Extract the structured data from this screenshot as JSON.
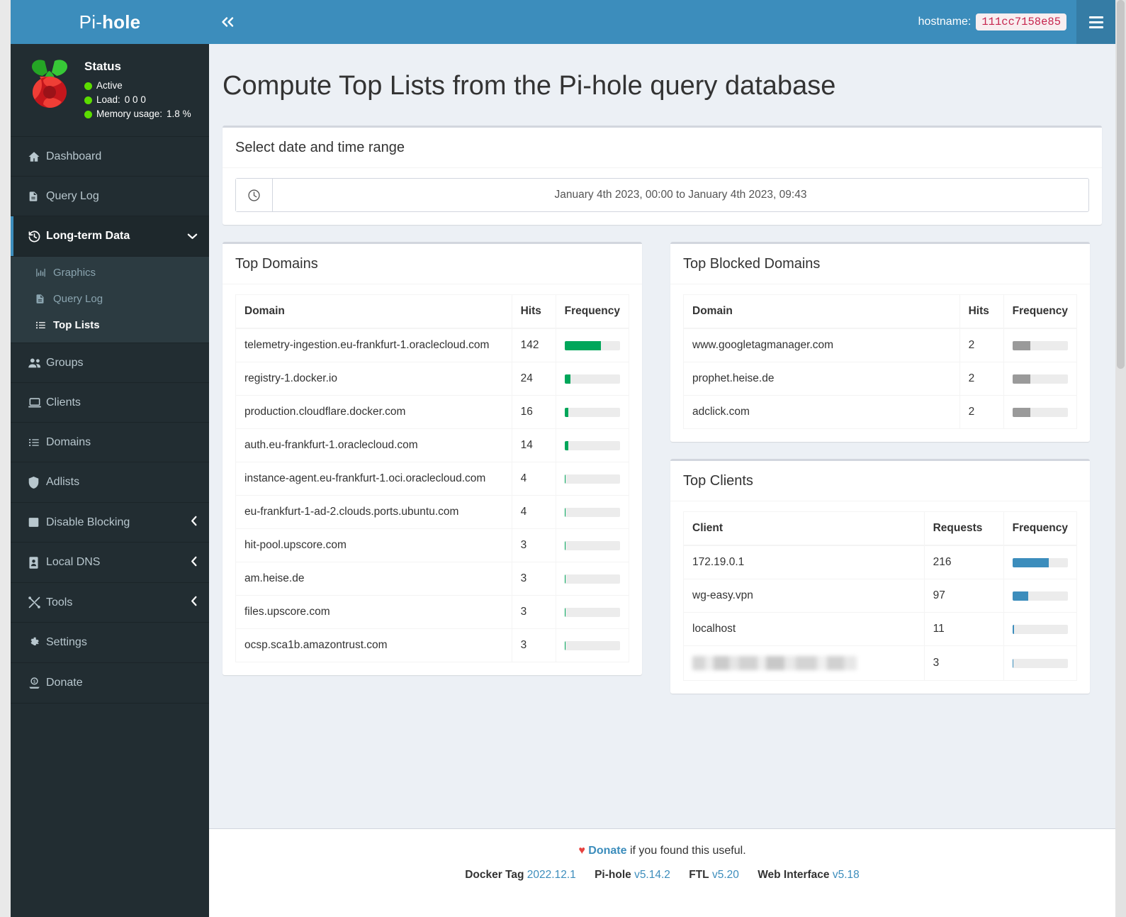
{
  "brand": {
    "prefix": "Pi-",
    "suffix": "hole"
  },
  "status": {
    "heading": "Status",
    "items": [
      {
        "label": "Active",
        "value": ""
      },
      {
        "label": "Load:",
        "value": "0  0  0"
      },
      {
        "label": "Memory usage:",
        "value": "1.8 %"
      }
    ],
    "dot_color": "#5cdd00"
  },
  "sidebar": {
    "items": [
      {
        "label": "Dashboard",
        "icon": "home-icon"
      },
      {
        "label": "Query Log",
        "icon": "file-icon"
      },
      {
        "label": "Long-term Data",
        "icon": "history-icon",
        "expanded": true,
        "caret": "⌄"
      },
      {
        "label": "Groups",
        "icon": "users-icon"
      },
      {
        "label": "Clients",
        "icon": "laptop-icon"
      },
      {
        "label": "Domains",
        "icon": "list-icon"
      },
      {
        "label": "Adlists",
        "icon": "shield-icon"
      },
      {
        "label": "Disable Blocking",
        "icon": "square-icon",
        "caret": "‹"
      },
      {
        "label": "Local DNS",
        "icon": "address-book-icon",
        "caret": "‹"
      },
      {
        "label": "Tools",
        "icon": "tools-icon",
        "caret": "‹"
      },
      {
        "label": "Settings",
        "icon": "gear-icon"
      },
      {
        "label": "Donate",
        "icon": "donate-icon"
      }
    ],
    "submenu": [
      {
        "label": "Graphics",
        "icon": "chart-icon",
        "active": false
      },
      {
        "label": "Query Log",
        "icon": "file-icon",
        "active": false
      },
      {
        "label": "Top Lists",
        "icon": "list-icon",
        "active": true
      }
    ]
  },
  "topbar": {
    "collapse_label": "«",
    "hostname_label": "hostname:",
    "hostname_value": "111cc7158e85"
  },
  "main": {
    "page_title": "Compute Top Lists from the Pi-hole query database",
    "daterange": {
      "panel_title": "Select date and time range",
      "value": "January 4th 2023, 00:00 to January 4th 2023, 09:43"
    }
  },
  "top_domains": {
    "title": "Top Domains",
    "columns": [
      "Domain",
      "Hits",
      "Frequency"
    ],
    "rows": [
      {
        "domain": "telemetry-ingestion.eu-frankfurt-1.oraclecloud.com",
        "hits": "142",
        "pct": 65
      },
      {
        "domain": "registry-1.docker.io",
        "hits": "24",
        "pct": 11
      },
      {
        "domain": "production.cloudflare.docker.com",
        "hits": "16",
        "pct": 7.3
      },
      {
        "domain": "auth.eu-frankfurt-1.oraclecloud.com",
        "hits": "14",
        "pct": 6.4
      },
      {
        "domain": "instance-agent.eu-frankfurt-1.oci.oraclecloud.com",
        "hits": "4",
        "pct": 2.4
      },
      {
        "domain": "eu-frankfurt-1-ad-2.clouds.ports.ubuntu.com",
        "hits": "4",
        "pct": 2.4
      },
      {
        "domain": "hit-pool.upscore.com",
        "hits": "3",
        "pct": 1.7
      },
      {
        "domain": "am.heise.de",
        "hits": "3",
        "pct": 1.7
      },
      {
        "domain": "files.upscore.com",
        "hits": "3",
        "pct": 1.7
      },
      {
        "domain": "ocsp.sca1b.amazontrust.com",
        "hits": "3",
        "pct": 1.7
      }
    ],
    "bar_color": "#00a65a"
  },
  "top_blocked_domains": {
    "title": "Top Blocked Domains",
    "columns": [
      "Domain",
      "Hits",
      "Frequency"
    ],
    "rows": [
      {
        "domain": "www.googletagmanager.com",
        "hits": "2",
        "pct": 33
      },
      {
        "domain": "prophet.heise.de",
        "hits": "2",
        "pct": 33
      },
      {
        "domain": "adclick.com",
        "hits": "2",
        "pct": 33
      }
    ],
    "bar_color": "#9a9a9a"
  },
  "top_clients": {
    "title": "Top Clients",
    "columns": [
      "Client",
      "Requests",
      "Frequency"
    ],
    "rows": [
      {
        "client": "172.19.0.1",
        "requests": "216",
        "pct": 65,
        "redacted": false
      },
      {
        "client": "wg-easy.vpn",
        "requests": "97",
        "pct": 29,
        "redacted": false
      },
      {
        "client": "localhost",
        "requests": "11",
        "pct": 3.3,
        "redacted": false
      },
      {
        "client": "",
        "requests": "3",
        "pct": 0.9,
        "redacted": true
      }
    ],
    "bar_color": "#3c8dbc"
  },
  "footer": {
    "heart": "♥",
    "donate_link": "Donate",
    "donate_tail": "if you found this useful.",
    "versions": [
      {
        "name": "Docker Tag",
        "value": "2022.12.1"
      },
      {
        "name": "Pi-hole",
        "value": "v5.14.2"
      },
      {
        "name": "FTL",
        "value": "v5.20"
      },
      {
        "name": "Web Interface",
        "value": "v5.18"
      }
    ]
  }
}
